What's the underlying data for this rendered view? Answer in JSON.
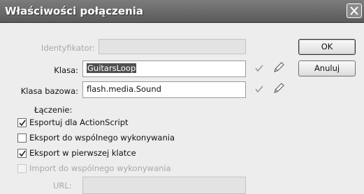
{
  "dialog": {
    "title": "Właściwości połączenia",
    "close_icon": "close-icon"
  },
  "fields": {
    "identifier": {
      "label": "Identyfikator:",
      "value": ""
    },
    "class": {
      "label": "Klasa:",
      "value": "GuitarsLoop"
    },
    "base_class": {
      "label": "Klasa bazowa:",
      "value": "flash.media.Sound"
    },
    "url": {
      "label": "URL:",
      "value": ""
    }
  },
  "buttons": {
    "ok": "OK",
    "cancel": "Anuluj"
  },
  "linkage": {
    "label": "Łączenie:",
    "options": [
      {
        "label": "Esportuj dla ActionScript",
        "checked": true,
        "enabled": true
      },
      {
        "label": "Eksport do wspólnego wykonywania",
        "checked": false,
        "enabled": true
      },
      {
        "label": "Eksport w pierwszej klatce",
        "checked": true,
        "enabled": true
      },
      {
        "label": "Import do wspólnego wykonywania",
        "checked": false,
        "enabled": false
      }
    ]
  },
  "icons": {
    "validate": "checkmark-icon",
    "edit": "pencil-icon",
    "checkbox_check": "checkbox-check-icon"
  },
  "colors": {
    "titlebar": "#6b6b6b",
    "dialog_bg": "#ededed",
    "selection": "#4f4f4f"
  }
}
